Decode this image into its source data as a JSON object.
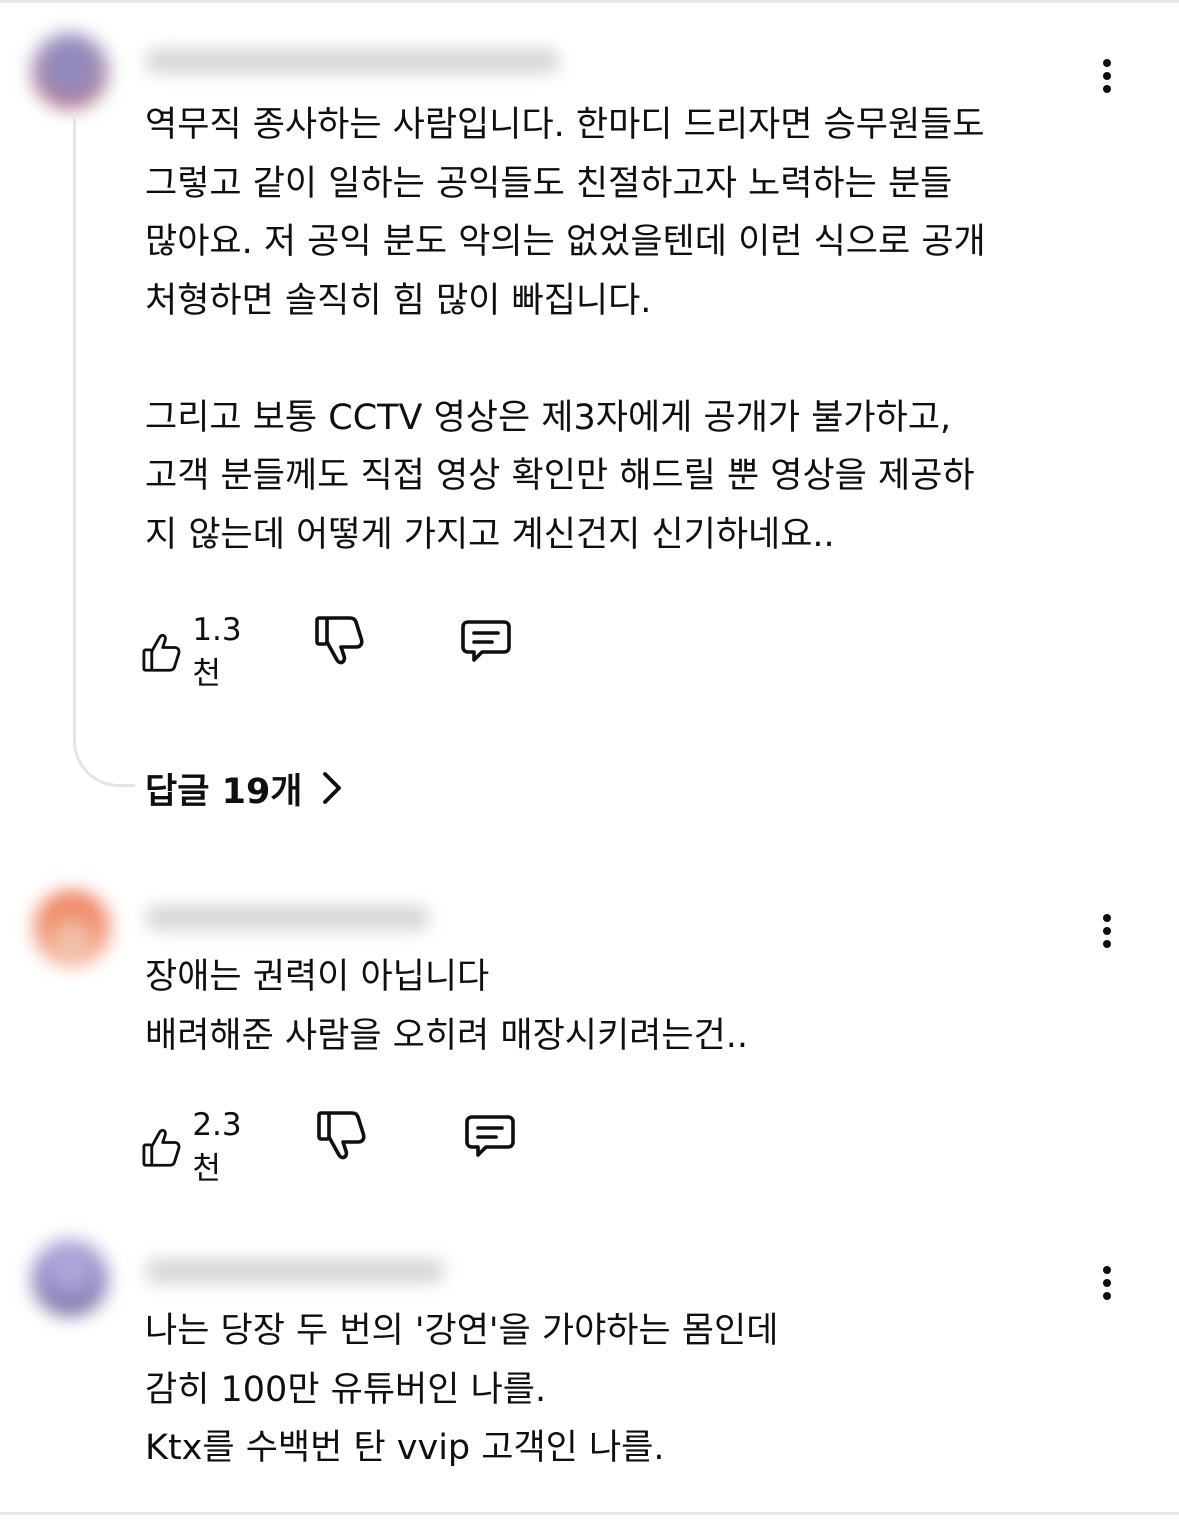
{
  "comments": [
    {
      "author": "",
      "text": "역무직 종사하는 사람입니다. 한마디 드리자면 승무원들도\n그렇고 같이 일하는 공익들도 친절하고자 노력하는 분들\n많아요. 저 공익 분도 악의는 없었을텐데 이런 식으로 공개\n처형하면 솔직히 힘 많이 빠집니다.\n\n그리고 보통 CCTV 영상은 제3자에게 공개가 불가하고,\n고객 분들께도 직접 영상 확인만 해드릴 뿐 영상을 제공하\n지 않는데 어떻게 가지고 계신건지 신기하네요..",
      "likes": "1.3천",
      "replies_label": "답글 19개",
      "icons": {
        "like": "thumbs-up-icon",
        "dislike": "thumbs-down-icon",
        "reply": "comment-icon",
        "more": "more-vert-icon",
        "chevron": "chevron-right-icon"
      }
    },
    {
      "author": "",
      "text": "장애는 권력이 아닙니다\n배려해준 사람을 오히려 매장시키려는건..",
      "likes": "2.3천",
      "icons": {
        "like": "thumbs-up-icon",
        "dislike": "thumbs-down-icon",
        "reply": "comment-icon",
        "more": "more-vert-icon"
      }
    },
    {
      "author": "",
      "text": "나는 당장 두 번의 '강연'을 가야하는 몸인데\n감히 100만 유튜버인 나를.\nKtx를 수백번 탄 vvip 고객인 나를.",
      "icons": {
        "more": "more-vert-icon"
      }
    }
  ],
  "colors": {
    "text": "#0f0f0f",
    "thread_line": "#e5e5e5",
    "frame": "#e6e6e6"
  }
}
